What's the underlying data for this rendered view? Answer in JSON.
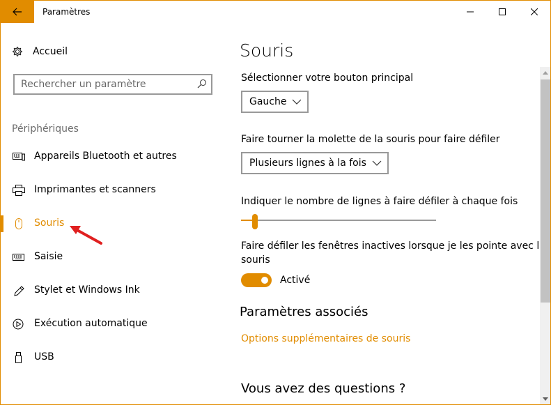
{
  "titlebar": {
    "title": "Paramètres"
  },
  "accent": "#e18c00",
  "sidebar": {
    "home_label": "Accueil",
    "search_placeholder": "Rechercher un paramètre",
    "section": "Périphériques",
    "items": [
      {
        "label": "Appareils Bluetooth et autres",
        "icon": "bluetooth-devices-icon"
      },
      {
        "label": "Imprimantes et scanners",
        "icon": "printer-icon"
      },
      {
        "label": "Souris",
        "icon": "mouse-icon",
        "active": true
      },
      {
        "label": "Saisie",
        "icon": "keyboard-icon"
      },
      {
        "label": "Stylet et Windows Ink",
        "icon": "pen-icon"
      },
      {
        "label": "Exécution automatique",
        "icon": "autoplay-icon"
      },
      {
        "label": "USB",
        "icon": "usb-icon"
      }
    ]
  },
  "main": {
    "title": "Souris",
    "primary_button_label": "Sélectionner votre bouton principal",
    "primary_button_value": "Gauche",
    "wheel_label": "Faire tourner la molette de la souris pour faire défiler",
    "wheel_value": "Plusieurs lignes à la fois",
    "lines_label": "Indiquer le nombre de lignes à faire défiler à chaque fois",
    "lines_slider_fraction": 0.06,
    "inactive_label_line1": "Faire défiler les fenêtres inactives lorsque je les pointe avec la",
    "inactive_label_line2": "souris",
    "toggle_state": "Activé",
    "related_heading": "Paramètres associés",
    "related_link": "Options supplémentaires de souris",
    "questions_heading": "Vous avez des questions ?"
  }
}
